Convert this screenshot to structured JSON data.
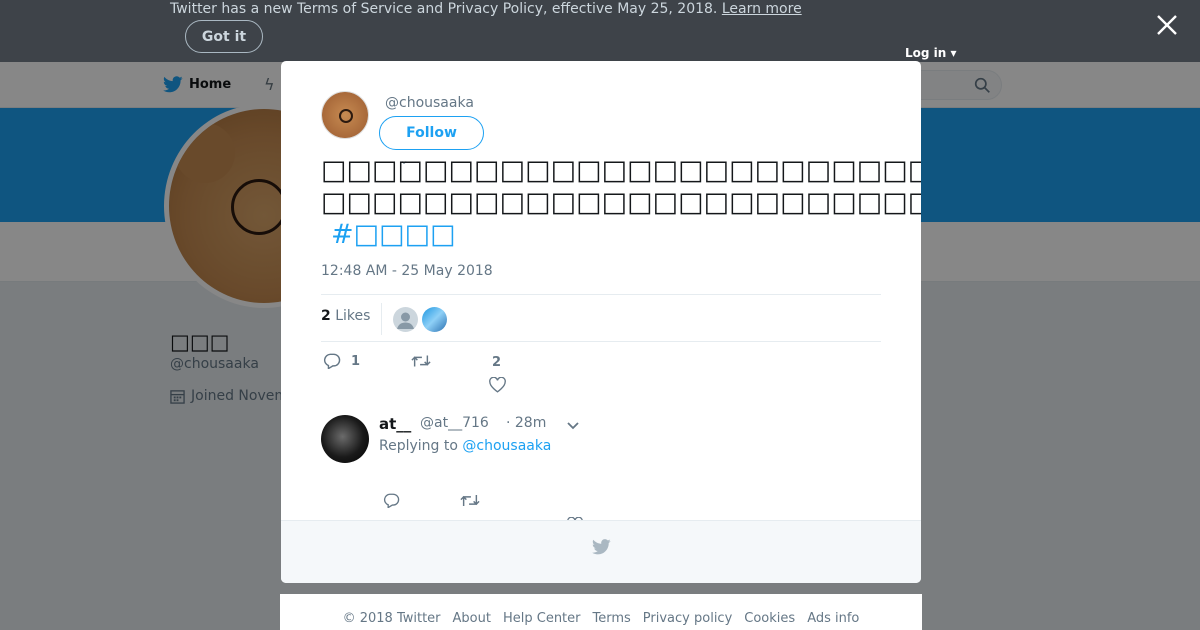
{
  "notice": {
    "text": "Twitter has a new Terms of Service and Privacy Policy, effective May 25, 2018.",
    "link": "Learn more",
    "button": "Got it"
  },
  "background": {
    "nav_home": "Home",
    "login": "Log in",
    "profile_name": "□□□",
    "profile_handle": "@chousaaka",
    "joined": "Joined Novem"
  },
  "tweet": {
    "handle": "@chousaaka",
    "follow_label": "Follow",
    "text_line1": "□□□□□□□□□□□□□□□□□□□□□□□□□□□□□□…□",
    "text_line2": "□□□□□□□□□□□□□□□□□□□□□□□□□□□□□□□□□□□□□□□□□□□□□□□□□□□",
    "hashtag": "#□□□□",
    "timestamp": "12:48 AM - 25 May 2018",
    "likes_count": "2",
    "likes_label": "Likes",
    "reply_count": "1",
    "like_count_action": "2"
  },
  "reply": {
    "name": "at__",
    "handle": "@at__716",
    "time": "· 28m",
    "replying_prefix": "Replying to",
    "replying_to": "@chousaaka"
  },
  "footer_links": [
    "© 2018 Twitter",
    "About",
    "Help Center",
    "Terms",
    "Privacy policy",
    "Cookies",
    "Ads info"
  ],
  "colors": {
    "accent": "#1da1f2",
    "notice_bg": "#3e4349",
    "muted": "#657786"
  }
}
